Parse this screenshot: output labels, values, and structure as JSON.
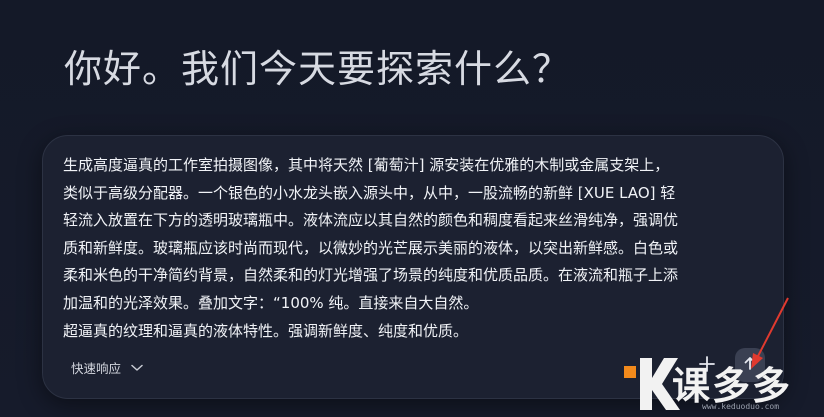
{
  "greeting": "你好。我们今天要探索什么？",
  "composer": {
    "prompt": "生成高度逼真的工作室拍摄图像，其中将天然 [葡萄汁] 源安装在优雅的木制或金属支架上，\n类似于高级分配器。一个银色的小水龙头嵌入源头中，从中，一股流畅的新鲜 [XUE LAO] 轻\n轻流入放置在下方的透明玻璃瓶中。液体流应以其自然的颜色和稠度看起来丝滑纯净，强调优\n质和新鲜度。玻璃瓶应该时尚而现代，以微妙的光芒展示美丽的液体，以突出新鲜感。白色或\n柔和米色的干净简约背景，自然柔和的灯光增强了场景的纯度和优质品质。在液流和瓶子上添\n加温和的光泽效果。叠加文字：“100% 纯。直接来自大自然。\n超逼真的纹理和逼真的液体特性。强调新鲜度、纯度和优质。",
    "mode_label": "快速响应",
    "add_icon": "plus-icon",
    "send_icon": "send-icon",
    "dropdown_icon": "chevron-down-icon"
  },
  "annotation": {
    "arrow_color": "#e03a2f"
  },
  "watermark": {
    "text": "课多多",
    "url": "www.keduoduo.com",
    "accent": "#f28a1c"
  }
}
